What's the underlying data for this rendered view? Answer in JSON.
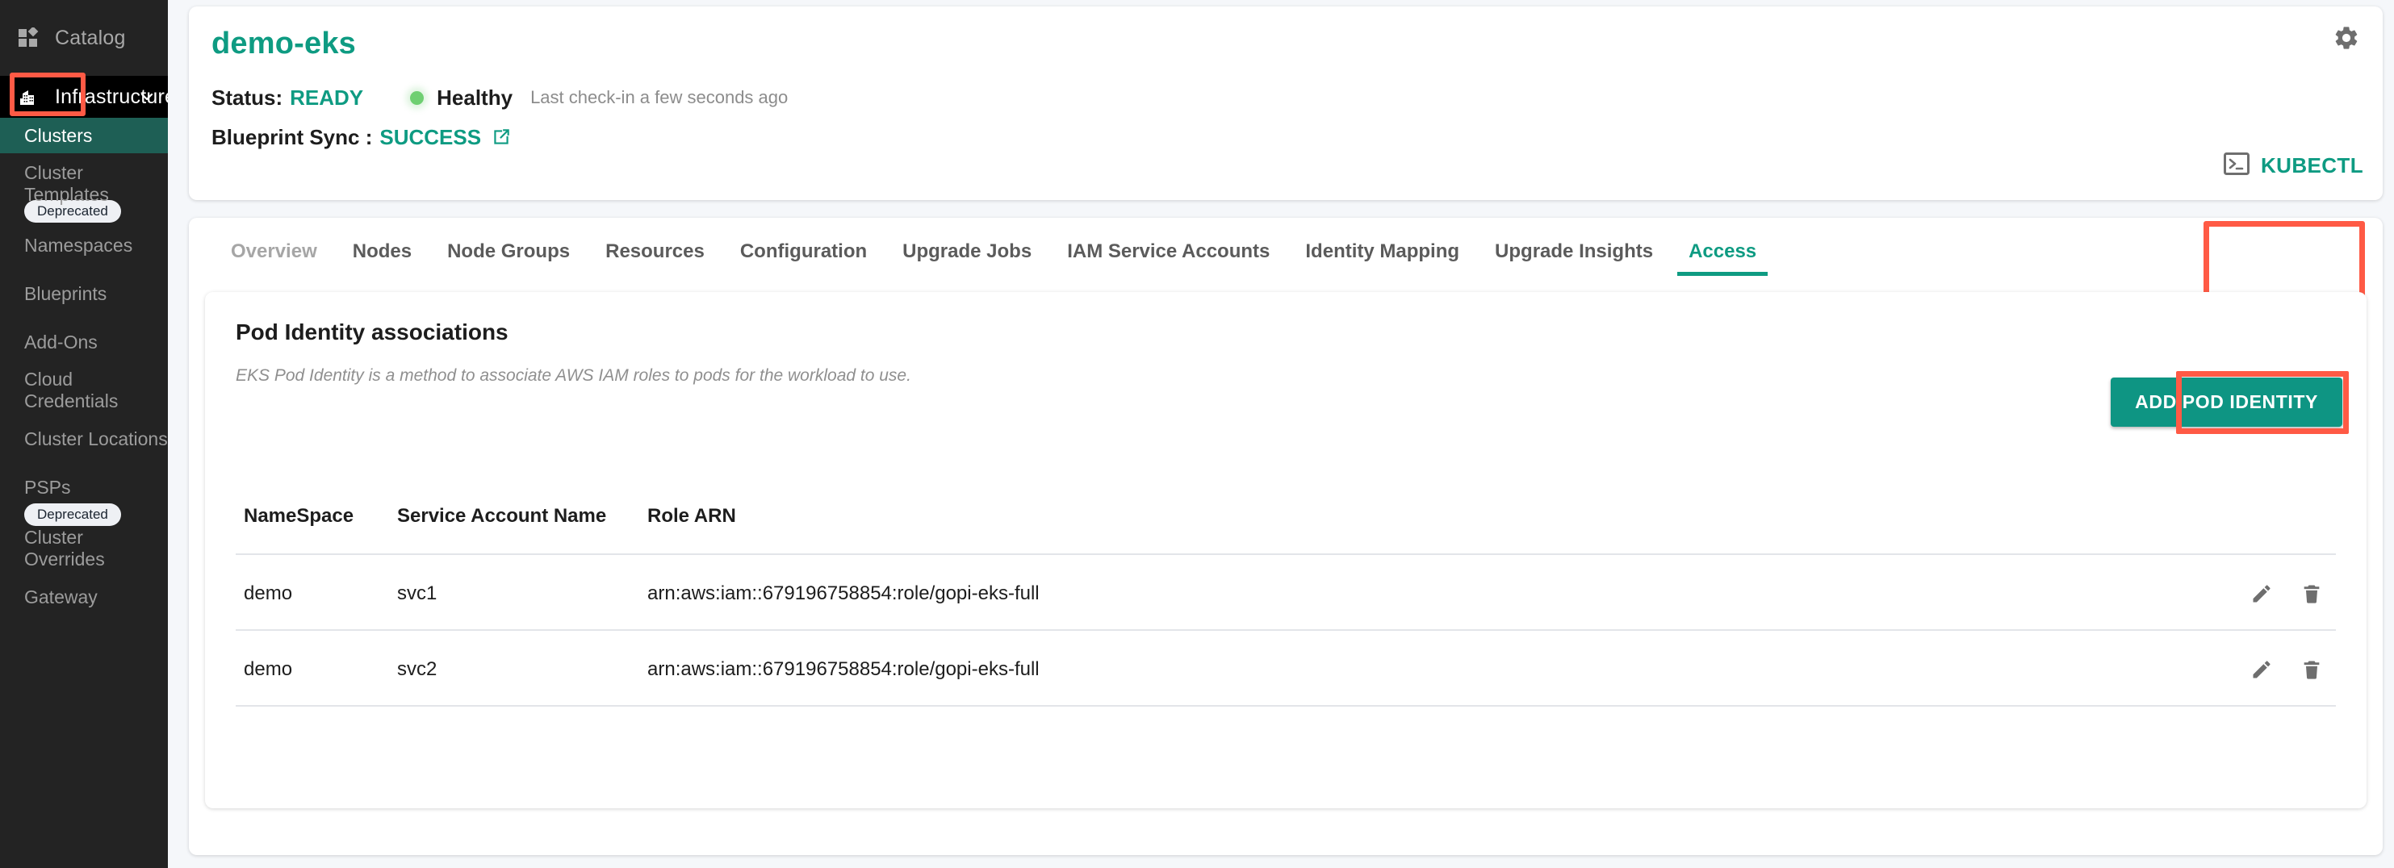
{
  "sidebar": {
    "catalog": {
      "label": "Catalog",
      "icon": "grid-icon"
    },
    "infrastructure": {
      "label": "Infrastructure",
      "icon": "building-icon",
      "chevron": "chevron-down-icon"
    },
    "items": [
      {
        "label": "Clusters",
        "active": true,
        "badge": null
      },
      {
        "label": "Cluster Templates",
        "active": false,
        "badge": "Deprecated"
      },
      {
        "label": "Namespaces",
        "active": false,
        "badge": null
      },
      {
        "label": "Blueprints",
        "active": false,
        "badge": null
      },
      {
        "label": "Add-Ons",
        "active": false,
        "badge": null
      },
      {
        "label": "Cloud Credentials",
        "active": false,
        "badge": null
      },
      {
        "label": "Cluster Locations",
        "active": false,
        "badge": null
      },
      {
        "label": "PSPs",
        "active": false,
        "badge": "Deprecated"
      },
      {
        "label": "Cluster Overrides",
        "active": false,
        "badge": null
      },
      {
        "label": "Gateway",
        "active": false,
        "badge": null
      }
    ]
  },
  "header": {
    "cluster_name": "demo-eks",
    "status_label": "Status:",
    "status_value": "READY",
    "health_label": "Healthy",
    "checkin": "Last check-in a few seconds ago",
    "blueprint_label": "Blueprint Sync :",
    "blueprint_value": "SUCCESS",
    "external_link_icon": "external-link-icon",
    "gear_icon": "gear-icon",
    "kubectl_label": "KUBECTL",
    "kubectl_icon": "terminal-icon"
  },
  "tabs": [
    {
      "label": "Overview",
      "state": "dim"
    },
    {
      "label": "Nodes",
      "state": "normal"
    },
    {
      "label": "Node Groups",
      "state": "normal"
    },
    {
      "label": "Resources",
      "state": "normal"
    },
    {
      "label": "Configuration",
      "state": "normal"
    },
    {
      "label": "Upgrade Jobs",
      "state": "normal"
    },
    {
      "label": "IAM Service Accounts",
      "state": "normal"
    },
    {
      "label": "Identity Mapping",
      "state": "normal"
    },
    {
      "label": "Upgrade Insights",
      "state": "normal"
    },
    {
      "label": "Access",
      "state": "active"
    }
  ],
  "panel": {
    "title": "Pod Identity associations",
    "subtitle": "EKS Pod Identity is a method to associate AWS IAM roles to pods for the workload to use.",
    "add_button": "ADD POD IDENTITY",
    "columns": [
      "NameSpace",
      "Service Account Name",
      "Role ARN"
    ],
    "rows": [
      {
        "namespace": "demo",
        "service_account": "svc1",
        "role_arn": "arn:aws:iam::679196758854:role/gopi-eks-full",
        "edit_icon": "pencil-icon",
        "delete_icon": "trash-icon"
      },
      {
        "namespace": "demo",
        "service_account": "svc2",
        "role_arn": "arn:aws:iam::679196758854:role/gopi-eks-full",
        "edit_icon": "pencil-icon",
        "delete_icon": "trash-icon"
      }
    ]
  },
  "colors": {
    "accent_teal": "#0e9b82",
    "highlight_red": "#ff5a45",
    "sidebar_bg": "#232323",
    "sidebar_active": "#1e5f55",
    "health_green": "#6fcf72",
    "page_bg": "#f5f7fa"
  }
}
